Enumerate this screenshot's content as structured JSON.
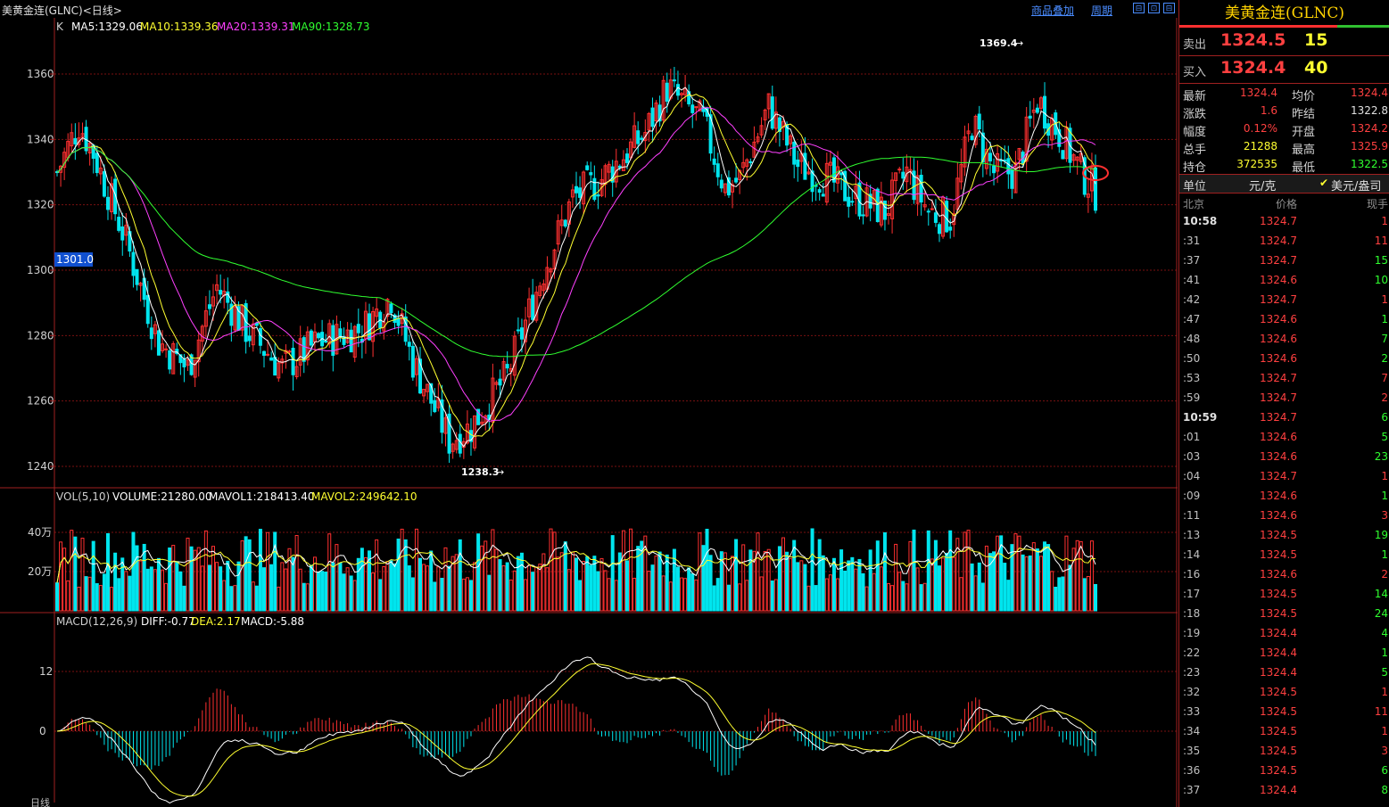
{
  "window": {
    "title": "美黄金连(GLNC)<日线>",
    "links": [
      "商品叠加",
      "周期"
    ],
    "buttons": [
      "⊟",
      "⊡",
      "⊟"
    ]
  },
  "colors": {
    "up": "#ff3030",
    "down": "#00e5ee",
    "ma5": "#ffffff",
    "ma10": "#ffff30",
    "ma20": "#ff40ff",
    "ma90": "#30ff30",
    "grid": "#7a1010"
  },
  "price_panel": {
    "indicator_prefix": "K",
    "ma5": "MA5:1329.06",
    "ma10": "MA10:1339.36",
    "ma20": "MA20:1339.31",
    "ma90": "MA90:1328.73",
    "y_ticks": [
      "1360",
      "1340",
      "1320",
      "1300",
      "1280",
      "1260",
      "1240"
    ],
    "high_marker": "1369.4",
    "low_marker": "1238.3",
    "cursor_price": "1301.0"
  },
  "volume_panel": {
    "label": "VOL(5,10)",
    "volume": "VOLUME:21280.00",
    "mavol1": "MAVOL1:218413.40",
    "mavol2": "MAVOL2:249642.10",
    "y_ticks": [
      "40万",
      "20万"
    ]
  },
  "macd_panel": {
    "label": "MACD(12,26,9)",
    "diff": "DIFF:-0.77",
    "dea": "DEA:2.17",
    "macd": "MACD:-5.88",
    "y_ticks": [
      "12",
      "0"
    ]
  },
  "x_axis_label": "日线",
  "quote": {
    "name": "美黄金连(GLNC)",
    "sell_label": "卖出",
    "sell_price": "1324.5",
    "sell_vol": "15",
    "buy_label": "买入",
    "buy_price": "1324.4",
    "buy_vol": "40",
    "stats": [
      {
        "l1": "最新",
        "v1": "1324.4",
        "c1": "red",
        "l2": "均价",
        "v2": "1324.4",
        "c2": "red"
      },
      {
        "l1": "涨跌",
        "v1": "1.6",
        "c1": "red",
        "l2": "昨结",
        "v2": "1322.8",
        "c2": "wht"
      },
      {
        "l1": "幅度",
        "v1": "0.12%",
        "c1": "red",
        "l2": "开盘",
        "v2": "1324.2",
        "c2": "red"
      },
      {
        "l1": "总手",
        "v1": "21288",
        "c1": "yel",
        "l2": "最高",
        "v2": "1325.9",
        "c2": "red"
      },
      {
        "l1": "持仓",
        "v1": "372535",
        "c1": "yel",
        "l2": "最低",
        "v2": "1322.5",
        "c2": "grn"
      }
    ],
    "unit_label": "单位",
    "unit_value": "元/克",
    "unit_alt": "美元/盎司",
    "tick_headers": [
      "北京",
      "价格",
      "现手"
    ],
    "ticks": [
      {
        "t": "10:58",
        "p": "1324.7",
        "v": "1",
        "vc": "red",
        "big": true
      },
      {
        "t": ":31",
        "p": "1324.7",
        "v": "11",
        "vc": "red"
      },
      {
        "t": ":37",
        "p": "1324.7",
        "v": "15",
        "vc": "grn"
      },
      {
        "t": ":41",
        "p": "1324.6",
        "v": "10",
        "vc": "grn"
      },
      {
        "t": ":42",
        "p": "1324.7",
        "v": "1",
        "vc": "red"
      },
      {
        "t": ":47",
        "p": "1324.6",
        "v": "1",
        "vc": "grn"
      },
      {
        "t": ":48",
        "p": "1324.6",
        "v": "7",
        "vc": "grn"
      },
      {
        "t": ":50",
        "p": "1324.6",
        "v": "2",
        "vc": "grn"
      },
      {
        "t": ":53",
        "p": "1324.7",
        "v": "7",
        "vc": "red"
      },
      {
        "t": ":59",
        "p": "1324.7",
        "v": "2",
        "vc": "red"
      },
      {
        "t": "10:59",
        "p": "1324.7",
        "v": "6",
        "vc": "grn",
        "big": true
      },
      {
        "t": ":01",
        "p": "1324.6",
        "v": "5",
        "vc": "grn"
      },
      {
        "t": ":03",
        "p": "1324.6",
        "v": "23",
        "vc": "grn"
      },
      {
        "t": ":04",
        "p": "1324.7",
        "v": "1",
        "vc": "red"
      },
      {
        "t": ":09",
        "p": "1324.6",
        "v": "1",
        "vc": "grn"
      },
      {
        "t": ":11",
        "p": "1324.6",
        "v": "3",
        "vc": "red"
      },
      {
        "t": ":13",
        "p": "1324.5",
        "v": "19",
        "vc": "grn"
      },
      {
        "t": ":14",
        "p": "1324.5",
        "v": "1",
        "vc": "grn"
      },
      {
        "t": ":16",
        "p": "1324.6",
        "v": "2",
        "vc": "red"
      },
      {
        "t": ":17",
        "p": "1324.5",
        "v": "14",
        "vc": "grn"
      },
      {
        "t": ":18",
        "p": "1324.5",
        "v": "24",
        "vc": "grn"
      },
      {
        "t": ":19",
        "p": "1324.4",
        "v": "4",
        "vc": "grn"
      },
      {
        "t": ":22",
        "p": "1324.4",
        "v": "1",
        "vc": "grn"
      },
      {
        "t": ":23",
        "p": "1324.4",
        "v": "5",
        "vc": "grn"
      },
      {
        "t": ":32",
        "p": "1324.5",
        "v": "1",
        "vc": "red"
      },
      {
        "t": ":33",
        "p": "1324.5",
        "v": "11",
        "vc": "red"
      },
      {
        "t": ":34",
        "p": "1324.5",
        "v": "1",
        "vc": "red"
      },
      {
        "t": ":35",
        "p": "1324.5",
        "v": "3",
        "vc": "red"
      },
      {
        "t": ":36",
        "p": "1324.5",
        "v": "6",
        "vc": "grn"
      },
      {
        "t": ":37",
        "p": "1324.4",
        "v": "8",
        "vc": "grn"
      }
    ]
  }
}
